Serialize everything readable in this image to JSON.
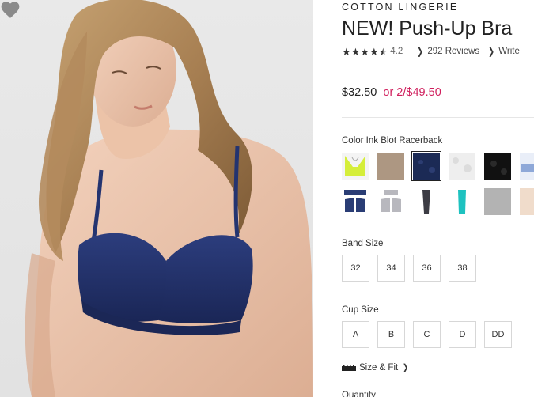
{
  "product": {
    "brand": "COTTON LINGERIE",
    "title": "NEW! Push-Up Bra",
    "rating": "4.2",
    "rating_stars": 4.2,
    "reviews_link": "292 Reviews",
    "write_link": "Write",
    "price": "$32.50",
    "promo": "or 2/$49.50"
  },
  "color": {
    "label": "Color Ink Blot Racerback",
    "swatches": [
      {
        "name": "neon-racerback",
        "hex": "#d5ee3a",
        "selected": false
      },
      {
        "name": "tan-texture",
        "hex": "#b59e8a",
        "selected": false
      },
      {
        "name": "ink-blot-racerback",
        "hex": "#1b2a55",
        "selected": true
      },
      {
        "name": "white-lace",
        "hex": "#ededed",
        "selected": false
      },
      {
        "name": "black-lace",
        "hex": "#111111",
        "selected": false
      },
      {
        "name": "blue-stripe",
        "hex": "#8ea8d8",
        "selected": false
      },
      {
        "name": "navy-lace-bra",
        "hex": "#2a3d75",
        "selected": false
      },
      {
        "name": "grey-lace-bra",
        "hex": "#b8b8be",
        "selected": false
      },
      {
        "name": "charcoal-lace",
        "hex": "#3c3c44",
        "selected": false
      },
      {
        "name": "teal-lace",
        "hex": "#1ec2c0",
        "selected": false
      },
      {
        "name": "heather-grey",
        "hex": "#b3b3b3",
        "selected": false
      },
      {
        "name": "nude",
        "hex": "#f0dccb",
        "selected": false
      }
    ]
  },
  "band_size": {
    "label": "Band Size",
    "options": [
      "32",
      "34",
      "36",
      "38"
    ]
  },
  "cup_size": {
    "label": "Cup Size",
    "options": [
      "A",
      "B",
      "C",
      "D",
      "DD"
    ]
  },
  "size_fit_link": "Size & Fit",
  "quantity_label": "Quantity",
  "colors": {
    "promo": "#d01f5d",
    "bra": "#24346f"
  }
}
